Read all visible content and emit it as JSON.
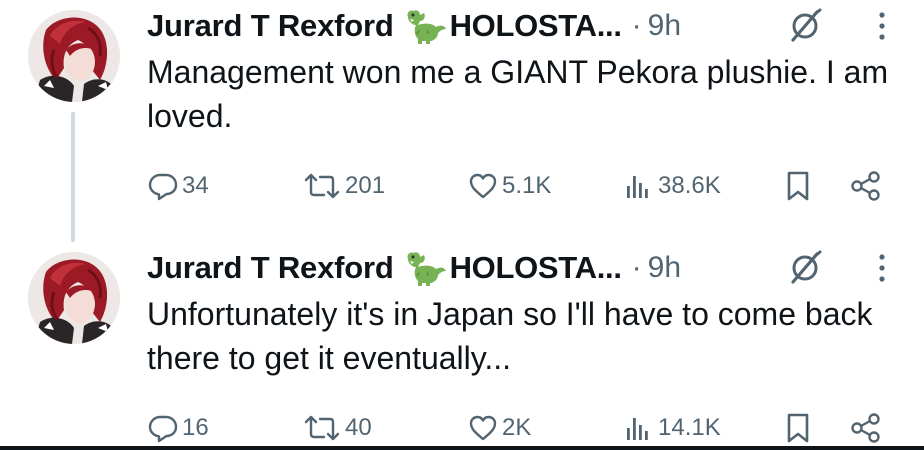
{
  "tweets": [
    {
      "author": {
        "name": "Jurard T Rexford",
        "name_suffix": "HOLOSTA...",
        "badge_icon": "dinosaur-emoji",
        "avatar_icon": "red-haired-anime-avatar"
      },
      "separator": "·",
      "time": "9h",
      "text": "Management won me a GIANT Pekora plushie. I am loved.",
      "stats": {
        "replies": "34",
        "retweets": "201",
        "likes": "5.1K",
        "views": "38.6K"
      }
    },
    {
      "author": {
        "name": "Jurard T Rexford",
        "name_suffix": "HOLOSTA...",
        "badge_icon": "dinosaur-emoji",
        "avatar_icon": "red-haired-anime-avatar"
      },
      "separator": "·",
      "time": "9h",
      "text": "Unfortunately it's in Japan so I'll have to come back there to get it eventually...",
      "stats": {
        "replies": "16",
        "retweets": "40",
        "likes": "2K",
        "views": "14.1K"
      }
    }
  ],
  "icons": {
    "reply": "speech-bubble-icon",
    "retweet": "retweet-arrows-icon",
    "like": "heart-icon",
    "views": "bar-chart-icon",
    "bookmark": "bookmark-icon",
    "share": "share-icon",
    "grok": "grok-slash-circle-icon",
    "more": "vertical-ellipsis-icon"
  },
  "colors": {
    "text": "#0f1419",
    "secondary": "#536471",
    "thread_line": "#cfd9de",
    "dino_green": "#77b255"
  }
}
